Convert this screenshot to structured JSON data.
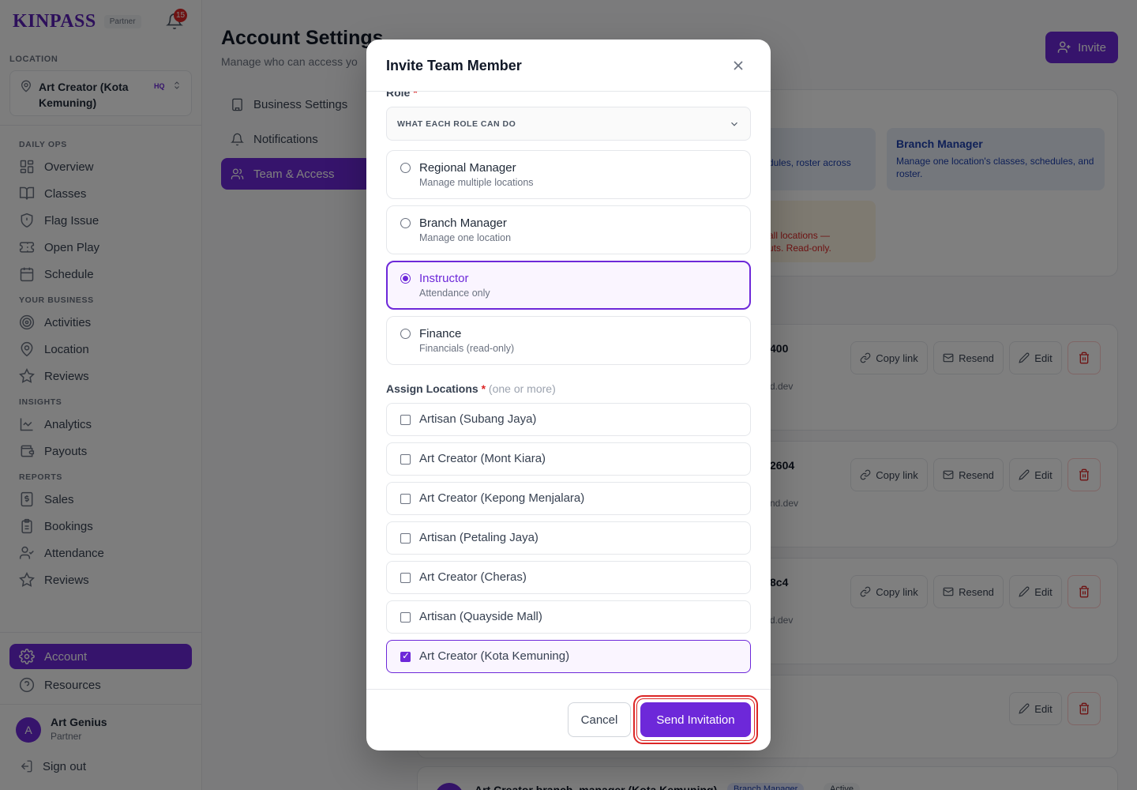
{
  "brand": {
    "logo": "KINPASS",
    "badge": "Partner",
    "notifications": "15"
  },
  "sidebar": {
    "location_label": "LOCATION",
    "location": {
      "name": "Art Creator (Kota Kemuning)",
      "tag": "HQ"
    },
    "groups": [
      {
        "label": "DAILY OPS",
        "items": [
          "Overview",
          "Classes",
          "Flag Issue",
          "Open Play",
          "Schedule"
        ]
      },
      {
        "label": "YOUR BUSINESS",
        "items": [
          "Activities",
          "Location",
          "Reviews"
        ]
      },
      {
        "label": "INSIGHTS",
        "items": [
          "Analytics",
          "Payouts"
        ]
      },
      {
        "label": "REPORTS",
        "items": [
          "Sales",
          "Bookings",
          "Attendance",
          "Reviews"
        ]
      }
    ],
    "account": "Account",
    "resources": "Resources",
    "user": {
      "initial": "A",
      "name": "Art Genius",
      "role": "Partner"
    },
    "sign_out": "Sign out"
  },
  "main": {
    "title": "Account Settings",
    "subtitle": "Manage who can access yo",
    "invite": "Invite",
    "nav": [
      "Business Settings",
      "Notifications",
      "Team & Access"
    ],
    "role_cards": [
      {
        "title": "",
        "desc": "dules, roster across",
        "color": "#1e40af"
      },
      {
        "title": "Branch Manager",
        "desc": "Manage one location's classes, schedules, and roster.",
        "color": "#1e40af"
      },
      {
        "title": "",
        "desc": "all locations — uts. Read-only.",
        "color": "#dc2626"
      }
    ],
    "rows": [
      {
        "code": "400",
        "mail": "d.dev"
      },
      {
        "code": "2604",
        "mail": "nd.dev"
      },
      {
        "code": "8c4",
        "mail": "d.dev"
      }
    ],
    "row_actions": {
      "copy": "Copy link",
      "resend": "Resend",
      "edit": "Edit"
    },
    "bottom_row": {
      "name": "Art Creator branch_manager (Kota Kemuning)",
      "role": "Branch Manager",
      "status": "Active"
    }
  },
  "modal": {
    "title": "Invite Team Member",
    "role_label": "Role",
    "required": "*",
    "what_each": "WHAT EACH ROLE CAN DO",
    "roles": [
      {
        "title": "Regional Manager",
        "desc": "Manage multiple locations"
      },
      {
        "title": "Branch Manager",
        "desc": "Manage one location"
      },
      {
        "title": "Instructor",
        "desc": "Attendance only"
      },
      {
        "title": "Finance",
        "desc": "Financials (read-only)"
      }
    ],
    "selected_role": "Instructor",
    "assign_label": "Assign Locations",
    "assign_hint": "(one or more)",
    "locations": [
      "Artisan (Subang Jaya)",
      "Art Creator (Mont Kiara)",
      "Art Creator (Kepong Menjalara)",
      "Artisan (Petaling Jaya)",
      "Art Creator (Cheras)",
      "Artisan (Quayside Mall)",
      "Art Creator (Kota Kemuning)"
    ],
    "checked_location": "Art Creator (Kota Kemuning)",
    "cancel": "Cancel",
    "send": "Send Invitation"
  },
  "colors": {
    "accent": "#6d28d9",
    "danger": "#dc2626"
  }
}
